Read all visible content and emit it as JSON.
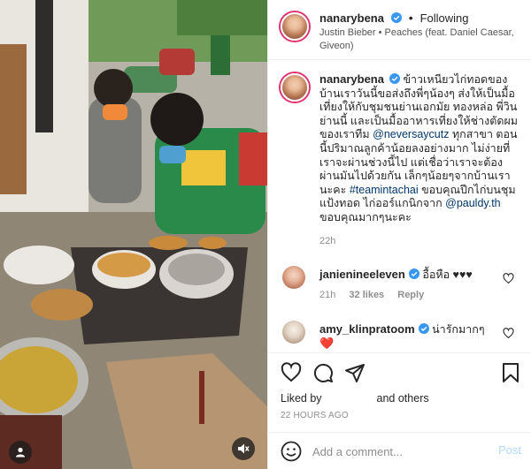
{
  "post": {
    "username": "nanarybena",
    "follow_status": "Following",
    "separator": "•",
    "song": "Justin Bieber • Peaches (feat. Daniel Caesar, Giveon)"
  },
  "caption": {
    "username": "nanarybena",
    "text_part1": "ข้าวเหนียวไก่ทอดของบ้านเราวันนี้ขอส่งถึงพี่ๆน้องๆ ส่งให้เป็นมื้อเที่ยงให้กับชุมชนย่านเอกมัย ทองหล่อ พี่วินย่านนี้ และเป็นมื้ออาหารเที่ยงให้ช่างตัดผมของเราทีม ",
    "mention1": "@neversaycutz",
    "text_part2": " ทุกสาขา ตอนนี้ปริมาณลูกค้าน้อยลงอย่างมาก ไม่ง่ายที่เราจะผ่านช่วงนี้ไป แต่เชื่อว่าเราจะต้องผ่านมันไปด้วยกัน เล็กๆน้อยๆจากบ้านเรานะคะ ",
    "hashtag": "#teamintachai",
    "text_part3": " ขอบคุณปีกไก่บนชุมแป้งทอด ไก่ออร์แกนิกจาก ",
    "mention2": "@pauldy.th",
    "text_part4": " ขอบคุณมากๆนะคะ",
    "time": "22h"
  },
  "comments": [
    {
      "username": "janienineeleven",
      "text": "อื้อหือ ♥♥♥",
      "time": "21h",
      "likes": "32 likes",
      "reply": "Reply"
    },
    {
      "username": "amy_klinpratoom",
      "text": "น่ารักมากๆ",
      "emoji": "❤️"
    }
  ],
  "actions": {
    "liked_by_prefix": "Liked by",
    "liked_by_suffix": "and others",
    "timestamp": "22 HOURS AGO"
  },
  "add_comment": {
    "placeholder": "Add a comment...",
    "post_label": "Post"
  },
  "colors": {
    "verified": "#3897f0",
    "link": "#00376b",
    "heart_red": "#ed4956",
    "post_disabled": "#b3dbff"
  }
}
